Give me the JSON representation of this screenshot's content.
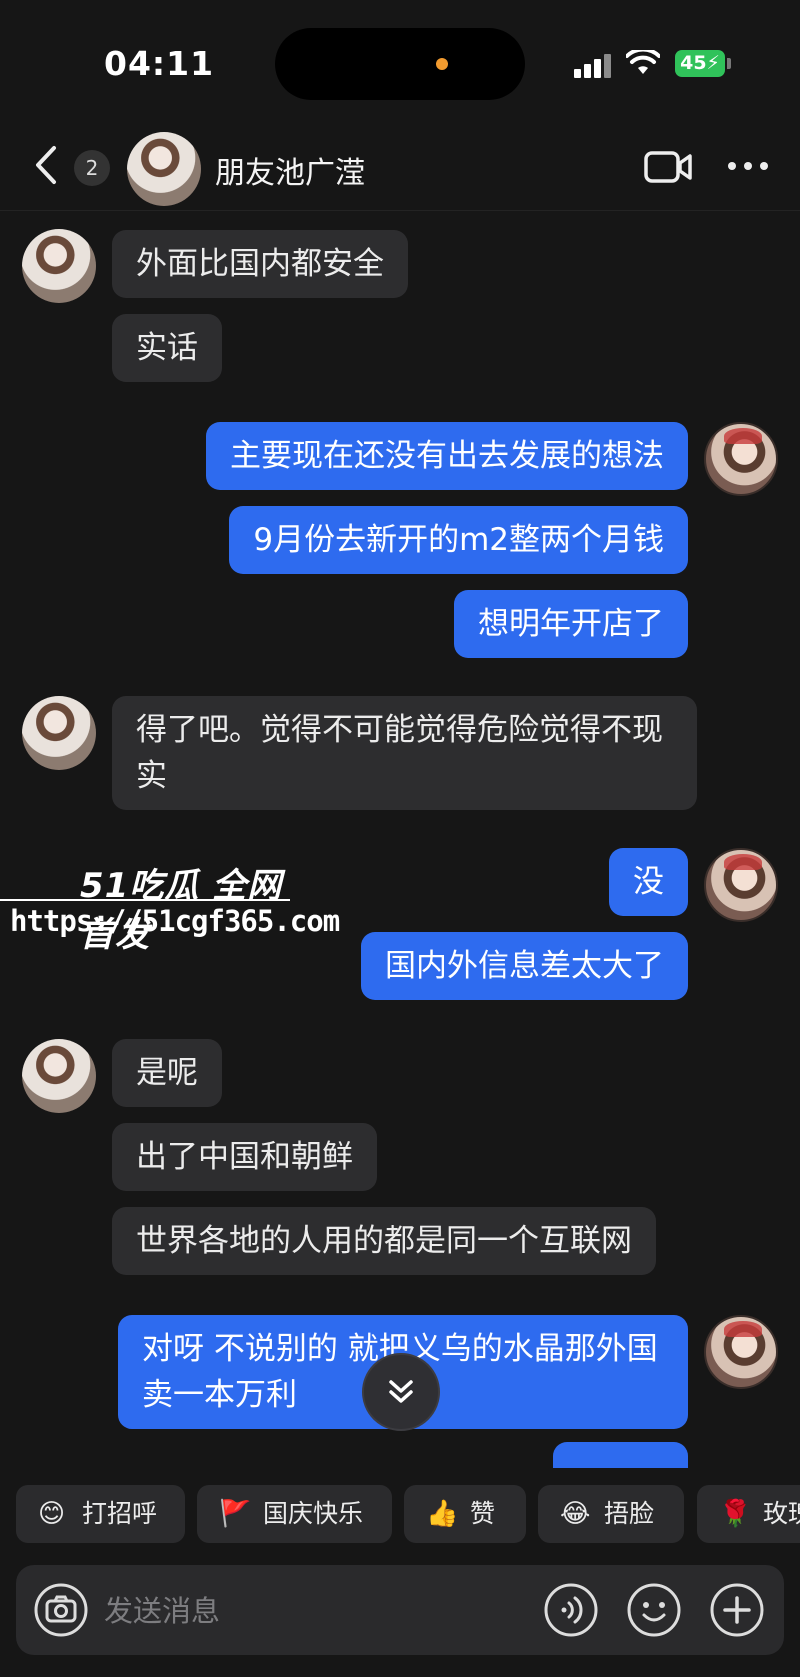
{
  "status": {
    "time": "04:11",
    "battery": "45"
  },
  "header": {
    "unread_count": "2",
    "contact_name": "朋友池广滢"
  },
  "messages": [
    {
      "side": "in",
      "text": "外面比国内都安全"
    },
    {
      "side": "in",
      "text": "实话"
    },
    {
      "side": "out",
      "text": "主要现在还没有出去发展的想法"
    },
    {
      "side": "out",
      "text": "9月份去新开的m2整两个月钱"
    },
    {
      "side": "out",
      "text": "想明年开店了"
    },
    {
      "side": "in",
      "text": "得了吧。觉得不可能觉得危险觉得不现实"
    },
    {
      "side": "out",
      "text": "没"
    },
    {
      "side": "out",
      "text": "国内外信息差太大了"
    },
    {
      "side": "in",
      "text": "是呢"
    },
    {
      "side": "in",
      "text": "出了中国和朝鲜"
    },
    {
      "side": "in",
      "text": "世界各地的人用的都是同一个互联网"
    },
    {
      "side": "out",
      "text": "对呀 不说别的 就把义乌的水晶那外国卖一本万利"
    }
  ],
  "watermark": {
    "brand": "51吃瓜 全网首发",
    "url": "https://51cgf365.com"
  },
  "quick_replies": [
    {
      "emoji": "😊",
      "label": "打招呼"
    },
    {
      "emoji": "🚩",
      "label": "国庆快乐"
    },
    {
      "emoji": "👍",
      "label": "赞"
    },
    {
      "emoji": "😂",
      "label": "捂脸"
    },
    {
      "emoji": "🌹",
      "label": "玫瑰"
    }
  ],
  "input": {
    "placeholder": "发送消息"
  }
}
